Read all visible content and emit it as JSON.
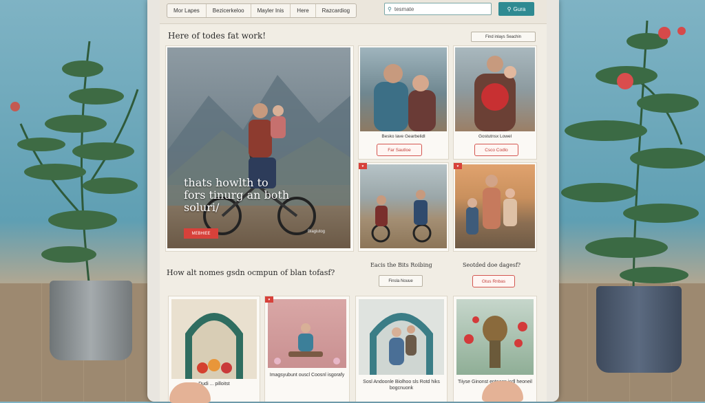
{
  "topbar": {
    "tabs": [
      "Mor Lapes",
      "Bezicerkeloo",
      "Mayler Inis",
      "Here",
      "Razcardiog"
    ],
    "search_placeholder": "tesmate",
    "search_button": "Gura"
  },
  "section1": {
    "heading": "Here of todes fat work!",
    "filter_button": "Find inlays Seachin",
    "hero": {
      "text_lines": [
        "thats howlth to",
        "fors tinurg an both",
        "soluri/"
      ],
      "button": "MEBHIEE",
      "tag": "Blagiutog"
    },
    "cards": [
      {
        "caption": "Besko lave Gearbelidl",
        "button": "Far Sautloe"
      },
      {
        "caption": "Gostutnsx Lowel",
        "button": "Csco Codlo"
      },
      {
        "caption": "",
        "button": ""
      },
      {
        "caption": "",
        "button": ""
      }
    ]
  },
  "section2": {
    "heading": "How alt nomes gsdn ocmpun of blan tofasf?",
    "label_a": "Eacis the Bits Roibing",
    "button_a": "Finsla Nouue",
    "label_b": "Seotded doe dagesf?",
    "button_b": "Gtus Rnbas",
    "cards": [
      {
        "caption": "Dudi ... pilloitst"
      },
      {
        "caption": "Imagsyubunt ouscl Coosnl isgorafy"
      },
      {
        "caption": "Sosl Andoonle Biolhoo sls Rotd hiks bogcnuonk"
      },
      {
        "caption": "Tiiyse Ginonst enteasn isdl heoneil"
      }
    ]
  },
  "colors": {
    "accent": "#2f8a92",
    "red": "#d7413a",
    "wall": "#6aa8ba",
    "screen": "#f1ede4"
  }
}
